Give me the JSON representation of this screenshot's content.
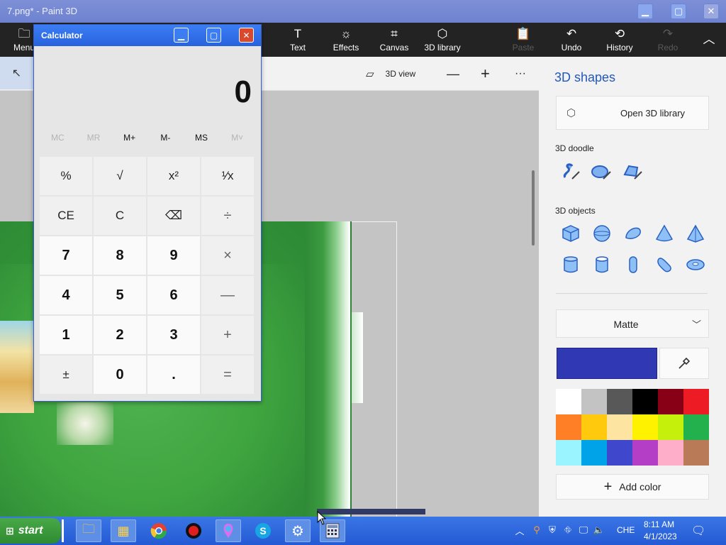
{
  "window": {
    "title": "7.png* - Paint 3D",
    "min_icon": "minimize-icon",
    "max_icon": "maximize-icon",
    "close_icon": "close-icon"
  },
  "ribbon": {
    "menu_label": "Menu",
    "items": [
      {
        "label": "Text",
        "icon": "text-icon",
        "enabled": true
      },
      {
        "label": "Effects",
        "icon": "effects-icon",
        "enabled": true
      },
      {
        "label": "Canvas",
        "icon": "canvas-icon",
        "enabled": true
      },
      {
        "label": "3D library",
        "icon": "library-icon",
        "enabled": true
      },
      {
        "label": "Paste",
        "icon": "paste-icon",
        "enabled": false
      },
      {
        "label": "Undo",
        "icon": "undo-icon",
        "enabled": true
      },
      {
        "label": "History",
        "icon": "history-icon",
        "enabled": true
      },
      {
        "label": "Redo",
        "icon": "redo-icon",
        "enabled": false
      }
    ]
  },
  "subbar": {
    "view_label": "3D view",
    "zoom_out": "—",
    "zoom_in": "+",
    "more": "···"
  },
  "side_panel": {
    "title": "3D shapes",
    "open_library": "Open 3D library",
    "doodle_label": "3D doodle",
    "objects_label": "3D objects",
    "material": "Matte",
    "current_color": "#3038b4",
    "add_color": "Add color",
    "palette": [
      "#ffffff",
      "#c3c3c3",
      "#585858",
      "#000000",
      "#880015",
      "#ed1c24",
      "#ff7f27",
      "#ffc90e",
      "#fde4a0",
      "#fff200",
      "#c4f00b",
      "#22b14c",
      "#99f4ff",
      "#00a2e8",
      "#3f48cc",
      "#b43ec6",
      "#ffaec9",
      "#b97a57"
    ]
  },
  "calculator": {
    "title": "Calculator",
    "display": "0",
    "memory": [
      {
        "label": "MC",
        "enabled": false
      },
      {
        "label": "MR",
        "enabled": false
      },
      {
        "label": "M+",
        "enabled": true
      },
      {
        "label": "M-",
        "enabled": true
      },
      {
        "label": "MS",
        "enabled": true
      },
      {
        "label": "M˅",
        "enabled": false
      }
    ],
    "keys": [
      {
        "label": "%",
        "kind": "fn"
      },
      {
        "label": "√",
        "kind": "fn"
      },
      {
        "label": "x²",
        "kind": "fn"
      },
      {
        "label": "¹⁄x",
        "kind": "fn"
      },
      {
        "label": "CE",
        "kind": "fn"
      },
      {
        "label": "C",
        "kind": "fn"
      },
      {
        "label": "⌫",
        "kind": "fn"
      },
      {
        "label": "÷",
        "kind": "op"
      },
      {
        "label": "7",
        "kind": "num"
      },
      {
        "label": "8",
        "kind": "num"
      },
      {
        "label": "9",
        "kind": "num"
      },
      {
        "label": "×",
        "kind": "op"
      },
      {
        "label": "4",
        "kind": "num"
      },
      {
        "label": "5",
        "kind": "num"
      },
      {
        "label": "6",
        "kind": "num"
      },
      {
        "label": "—",
        "kind": "op"
      },
      {
        "label": "1",
        "kind": "num"
      },
      {
        "label": "2",
        "kind": "num"
      },
      {
        "label": "3",
        "kind": "num"
      },
      {
        "label": "+",
        "kind": "op"
      },
      {
        "label": "±",
        "kind": "fn"
      },
      {
        "label": "0",
        "kind": "num"
      },
      {
        "label": ".",
        "kind": "num"
      },
      {
        "label": "=",
        "kind": "op"
      }
    ]
  },
  "taskbar": {
    "start_label": "start",
    "apps": [
      "file-explorer-icon",
      "store-icon",
      "chrome-icon",
      "record-icon",
      "paint3d-icon",
      "skype-icon",
      "settings-icon",
      "calculator-icon"
    ],
    "language": "CHE",
    "time": "8:11 AM",
    "date": "4/1/2023"
  }
}
